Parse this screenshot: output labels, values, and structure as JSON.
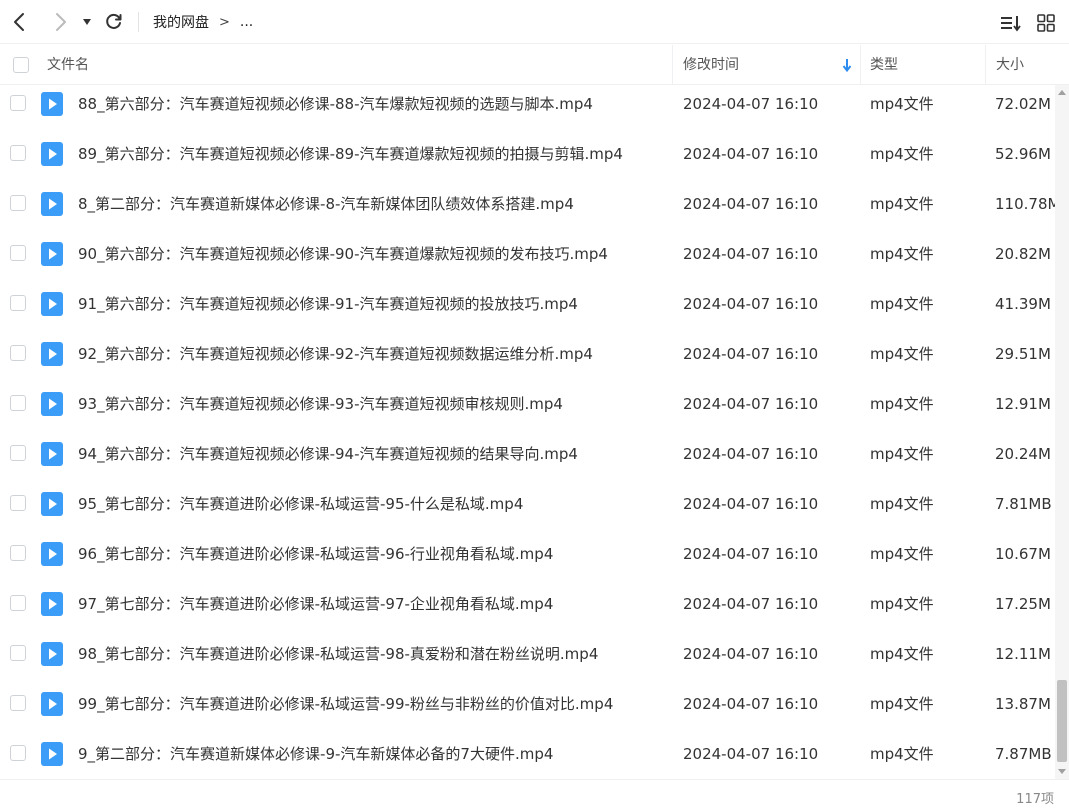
{
  "breadcrumb": {
    "root": "我的网盘",
    "separator": ">",
    "more": "..."
  },
  "header": {
    "name": "文件名",
    "modified": "修改时间",
    "type": "类型",
    "size": "大小"
  },
  "files": [
    {
      "name": "88_第六部分：汽车赛道短视频必修课-88-汽车爆款短视频的选题与脚本.mp4",
      "date": "2024-04-07 16:10",
      "type": "mp4文件",
      "size": "72.02M"
    },
    {
      "name": "89_第六部分：汽车赛道短视频必修课-89-汽车赛道爆款短视频的拍摄与剪辑.mp4",
      "date": "2024-04-07 16:10",
      "type": "mp4文件",
      "size": "52.96M"
    },
    {
      "name": "8_第二部分：汽车赛道新媒体必修课-8-汽车新媒体团队绩效体系搭建.mp4",
      "date": "2024-04-07 16:10",
      "type": "mp4文件",
      "size": "110.78M"
    },
    {
      "name": "90_第六部分：汽车赛道短视频必修课-90-汽车赛道爆款短视频的发布技巧.mp4",
      "date": "2024-04-07 16:10",
      "type": "mp4文件",
      "size": "20.82M"
    },
    {
      "name": "91_第六部分：汽车赛道短视频必修课-91-汽车赛道短视频的投放技巧.mp4",
      "date": "2024-04-07 16:10",
      "type": "mp4文件",
      "size": "41.39M"
    },
    {
      "name": "92_第六部分：汽车赛道短视频必修课-92-汽车赛道短视频数据运维分析.mp4",
      "date": "2024-04-07 16:10",
      "type": "mp4文件",
      "size": "29.51M"
    },
    {
      "name": "93_第六部分：汽车赛道短视频必修课-93-汽车赛道短视频审核规则.mp4",
      "date": "2024-04-07 16:10",
      "type": "mp4文件",
      "size": "12.91M"
    },
    {
      "name": "94_第六部分：汽车赛道短视频必修课-94-汽车赛道短视频的结果导向.mp4",
      "date": "2024-04-07 16:10",
      "type": "mp4文件",
      "size": "20.24M"
    },
    {
      "name": "95_第七部分：汽车赛道进阶必修课-私域运营-95-什么是私域.mp4",
      "date": "2024-04-07 16:10",
      "type": "mp4文件",
      "size": "7.81MB"
    },
    {
      "name": "96_第七部分：汽车赛道进阶必修课-私域运营-96-行业视角看私域.mp4",
      "date": "2024-04-07 16:10",
      "type": "mp4文件",
      "size": "10.67M"
    },
    {
      "name": "97_第七部分：汽车赛道进阶必修课-私域运营-97-企业视角看私域.mp4",
      "date": "2024-04-07 16:10",
      "type": "mp4文件",
      "size": "17.25M"
    },
    {
      "name": "98_第七部分：汽车赛道进阶必修课-私域运营-98-真爱粉和潜在粉丝说明.mp4",
      "date": "2024-04-07 16:10",
      "type": "mp4文件",
      "size": "12.11M"
    },
    {
      "name": "99_第七部分：汽车赛道进阶必修课-私域运营-99-粉丝与非粉丝的价值对比.mp4",
      "date": "2024-04-07 16:10",
      "type": "mp4文件",
      "size": "13.87M"
    },
    {
      "name": "9_第二部分：汽车赛道新媒体必修课-9-汽车新媒体必备的7大硬件.mp4",
      "date": "2024-04-07 16:10",
      "type": "mp4文件",
      "size": "7.87MB"
    }
  ],
  "footer": {
    "count": "117项"
  },
  "icons": {
    "back": "chevron-left-icon",
    "forward": "chevron-right-icon",
    "dropdown": "caret-down-icon",
    "refresh": "refresh-icon",
    "sort": "sort-list-icon",
    "grid": "grid-view-icon",
    "file": "video-file-icon",
    "sort_arrow": "arrow-down-icon"
  },
  "colors": {
    "accent": "#2d8cf0",
    "file_icon": "#3b9df7"
  }
}
